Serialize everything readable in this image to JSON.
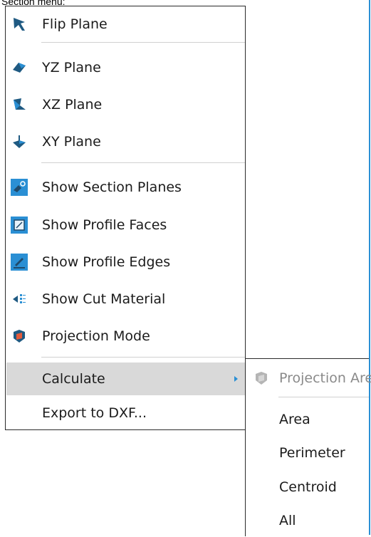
{
  "caption": "Section menu:",
  "menu": {
    "items": [
      {
        "label": "Flip Plane"
      },
      {
        "label": "YZ Plane"
      },
      {
        "label": "XZ Plane"
      },
      {
        "label": "XY Plane"
      },
      {
        "label": "Show Section Planes"
      },
      {
        "label": "Show Profile Faces"
      },
      {
        "label": "Show Profile Edges"
      },
      {
        "label": "Show Cut Material"
      },
      {
        "label": "Projection Mode"
      },
      {
        "label": "Calculate"
      },
      {
        "label": "Export to DXF..."
      }
    ]
  },
  "submenu": {
    "items": [
      {
        "label": "Projection Are"
      },
      {
        "label": "Area"
      },
      {
        "label": "Perimeter"
      },
      {
        "label": "Centroid"
      },
      {
        "label": "All"
      }
    ]
  },
  "colors": {
    "accent": "#2a8fd4",
    "icon_dark": "#1f5a82",
    "highlight": "#d9d9d9"
  }
}
